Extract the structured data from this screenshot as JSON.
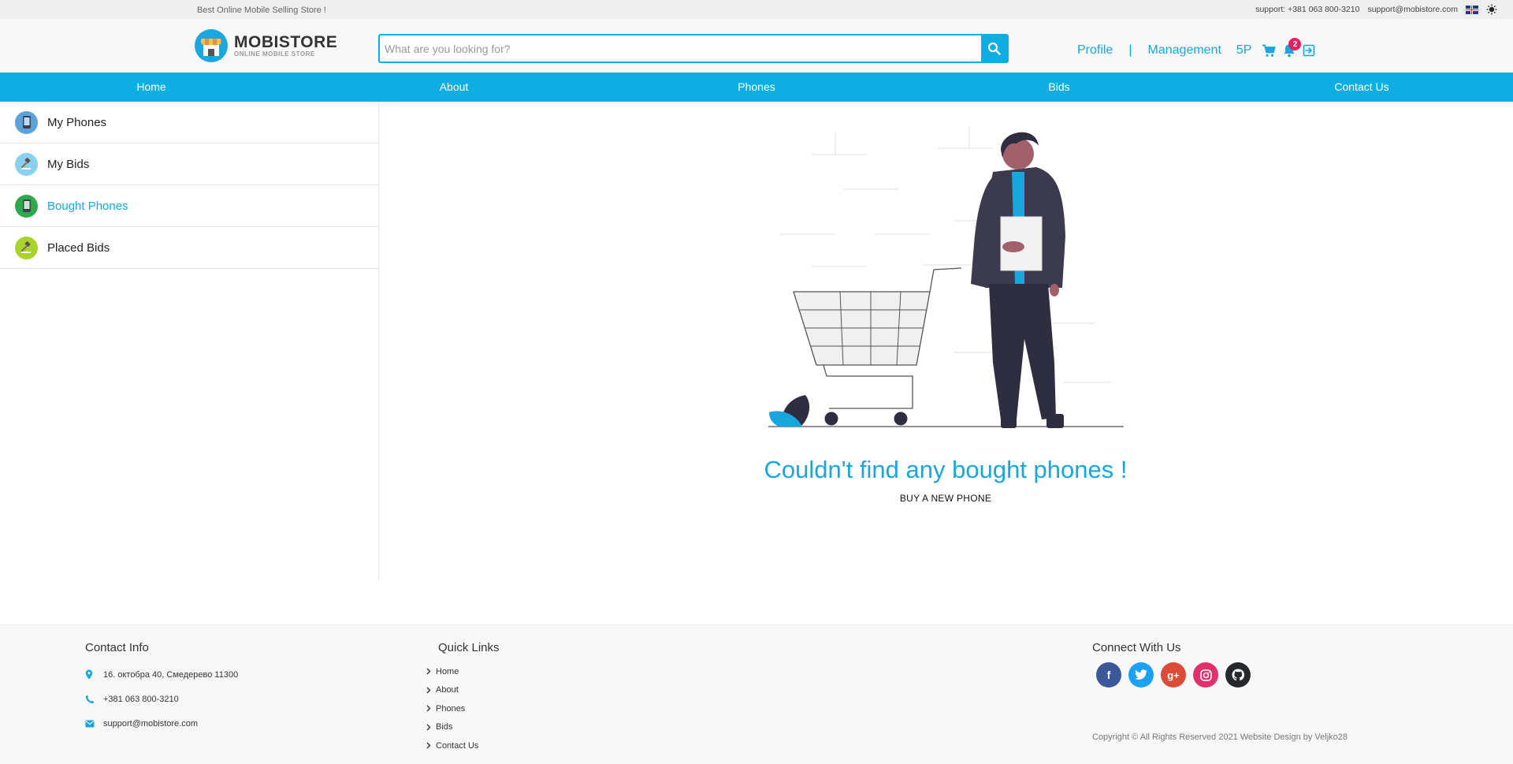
{
  "topbar": {
    "tagline": "Best Online Mobile Selling Store !",
    "support_phone": "support: +381 063 800-3210",
    "support_email": "support@mobistore.com"
  },
  "brand": {
    "title": "MOBISTORE",
    "subtitle": "ONLINE MOBILE STORE"
  },
  "search": {
    "placeholder": "What are you looking for?"
  },
  "user_nav": {
    "profile": "Profile",
    "separator": "|",
    "management": "Management",
    "points": "5P",
    "notification_count": "2"
  },
  "main_nav": [
    "Home",
    "About",
    "Phones",
    "Bids",
    "Contact Us"
  ],
  "sidebar": {
    "items": [
      {
        "label": "My Phones",
        "icon": "phone-icon",
        "color": "#5aa2d8",
        "active": false
      },
      {
        "label": "My Bids",
        "icon": "gavel-icon",
        "color": "#8ad0ef",
        "active": false
      },
      {
        "label": "Bought Phones",
        "icon": "phone-icon",
        "color": "#2eaa4b",
        "active": true
      },
      {
        "label": "Placed Bids",
        "icon": "gavel-icon",
        "color": "#a8d42b",
        "active": false
      }
    ]
  },
  "empty_state": {
    "title": "Couldn't find any bought phones !",
    "action": "BUY A NEW PHONE"
  },
  "footer": {
    "contact": {
      "title": "Contact Info",
      "address": "16. октобра 40, Смедерево 11300",
      "phone": "+381 063 800-3210",
      "email": "support@mobistore.com"
    },
    "quick_links": {
      "title": "Quick Links",
      "items": [
        "Home",
        "About",
        "Phones",
        "Bids",
        "Contact Us"
      ]
    },
    "connect": {
      "title": "Connect With Us",
      "socials": [
        {
          "name": "facebook",
          "glyph": "f",
          "color": "#3b5998"
        },
        {
          "name": "twitter",
          "glyph": "t",
          "color": "#1da1f2"
        },
        {
          "name": "google-plus",
          "glyph": "g+",
          "color": "#dd4b39"
        },
        {
          "name": "instagram",
          "glyph": "◎",
          "color": "#e1306c"
        },
        {
          "name": "github",
          "glyph": "◉",
          "color": "#24292e"
        }
      ]
    },
    "copyright": "Copyright © All Rights Reserved 2021 Website Design by Veljko28"
  },
  "colors": {
    "accent": "#0eaee3",
    "badge": "#e91e63"
  }
}
